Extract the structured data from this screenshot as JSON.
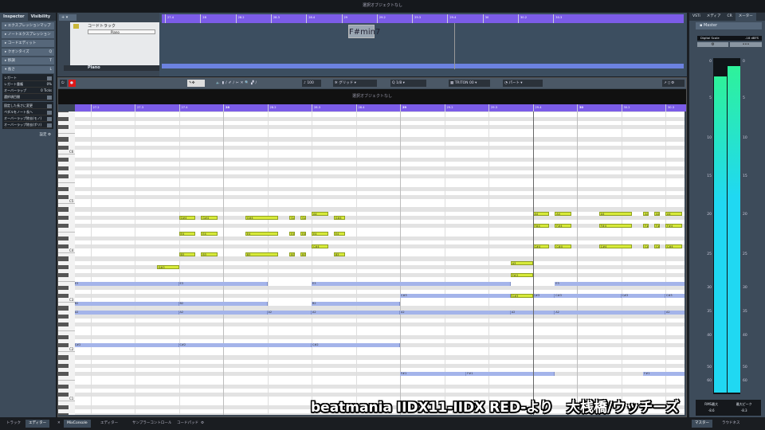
{
  "title": "選択オブジェクトなし",
  "inspector": {
    "tabs": [
      "Inspector",
      "Visibility"
    ],
    "sections": [
      "エクスプレッションマップ",
      "ノートエクスプレッション",
      "コードエディット",
      "クオンタイズ",
      "移調",
      "長さ"
    ],
    "length_rows": [
      {
        "label": "レガート",
        "value": ""
      },
      {
        "label": "レガート重複",
        "value": "0%"
      },
      {
        "label": "オーバーラップ",
        "value": "0 Ticks"
      },
      {
        "label": "選択項目間",
        "value": ""
      }
    ],
    "actions": [
      "固定した長さに変更",
      "ペダルをノート長へ",
      "オーバーラップ除去(モノ)",
      "オーバーラップ除去(ポリ)"
    ],
    "settings": "設定"
  },
  "arrange": {
    "chord_track": "コードトラック",
    "instrument": "Piano",
    "track_name": "Piano",
    "chord": "F#min7",
    "ruler": [
      "27.4",
      "28",
      "28.2",
      "28.3",
      "28.4",
      "29",
      "29.2",
      "29.3",
      "29.4",
      "30",
      "30.2",
      "30.3"
    ]
  },
  "toolbar": {
    "velocity": "100",
    "grid": "グリッド",
    "quantize": "1/8",
    "instrument": "TRITON 00",
    "part": "パート"
  },
  "editor": {
    "info": "選択オブジェクトなし",
    "ruler": [
      "27.2",
      "27.3",
      "27.4",
      "28",
      "28.2",
      "28.3",
      "28.4",
      "29",
      "29.2",
      "29.3",
      "29.4",
      "30",
      "30.2",
      "30.3"
    ],
    "octaves": [
      "C1",
      "C2",
      "C3",
      "C4",
      "C5",
      "C6"
    ],
    "playhead_beat": 11
  },
  "notes": [
    {
      "p": 68,
      "n": "G#4",
      "s": 3,
      "e": 3.375,
      "c": "y"
    },
    {
      "p": 68,
      "n": "G#4",
      "s": 3.5,
      "e": 3.875,
      "c": "y"
    },
    {
      "p": 68,
      "n": "G#4",
      "s": 4.5,
      "e": 5.25,
      "c": "y"
    },
    {
      "p": 68,
      "n": "G#4",
      "s": 5.5,
      "e": 5.625,
      "c": "y"
    },
    {
      "p": 68,
      "n": "G#4",
      "s": 5.75,
      "e": 5.875,
      "c": "y"
    },
    {
      "p": 69,
      "n": "A4",
      "s": 6,
      "e": 6.375,
      "c": "y"
    },
    {
      "p": 68,
      "n": "G#4",
      "s": 6.5,
      "e": 6.75,
      "c": "y"
    },
    {
      "p": 64,
      "n": "E4",
      "s": 3,
      "e": 3.375,
      "c": "y"
    },
    {
      "p": 64,
      "n": "E4",
      "s": 3.5,
      "e": 3.875,
      "c": "y"
    },
    {
      "p": 64,
      "n": "E4",
      "s": 4.5,
      "e": 5.25,
      "c": "y"
    },
    {
      "p": 64,
      "n": "E4",
      "s": 5.5,
      "e": 5.625,
      "c": "y"
    },
    {
      "p": 64,
      "n": "E4",
      "s": 5.75,
      "e": 5.875,
      "c": "y"
    },
    {
      "p": 64,
      "n": "E4",
      "s": 6,
      "e": 6.375,
      "c": "y"
    },
    {
      "p": 64,
      "n": "E4",
      "s": 6.5,
      "e": 6.75,
      "c": "y"
    },
    {
      "p": 61,
      "n": "C#4",
      "s": 6,
      "e": 6.375,
      "c": "y"
    },
    {
      "p": 59,
      "n": "B3",
      "s": 3,
      "e": 3.375,
      "c": "y"
    },
    {
      "p": 59,
      "n": "B3",
      "s": 3.5,
      "e": 3.875,
      "c": "y"
    },
    {
      "p": 59,
      "n": "B3",
      "s": 4.5,
      "e": 5.25,
      "c": "y"
    },
    {
      "p": 59,
      "n": "B3",
      "s": 5.5,
      "e": 5.625,
      "c": "y"
    },
    {
      "p": 59,
      "n": "B3",
      "s": 5.75,
      "e": 5.875,
      "c": "y"
    },
    {
      "p": 59,
      "n": "B3",
      "s": 6.5,
      "e": 6.75,
      "c": "y"
    },
    {
      "p": 56,
      "n": "G#3",
      "s": 2.5,
      "e": 3,
      "c": "y"
    },
    {
      "p": 52,
      "n": "E3",
      "s": 2.5,
      "e": 3,
      "c": "y"
    },
    {
      "p": 47,
      "n": "B2",
      "s": 2.5,
      "e": 3,
      "c": "y"
    },
    {
      "p": 52,
      "n": "E3",
      "s": 0.625,
      "e": 3,
      "c": "b"
    },
    {
      "p": 52,
      "n": "E3",
      "s": 3,
      "e": 5,
      "c": "b"
    },
    {
      "p": 52,
      "n": "E3",
      "s": 6,
      "e": 10.5,
      "c": "b"
    },
    {
      "p": 52,
      "n": "E3",
      "s": 11.5,
      "e": 14.5,
      "c": "b"
    },
    {
      "p": 47,
      "n": "B2",
      "s": 0.625,
      "e": 3,
      "c": "b"
    },
    {
      "p": 47,
      "n": "B2",
      "s": 3,
      "e": 5,
      "c": "b"
    },
    {
      "p": 47,
      "n": "B2",
      "s": 6,
      "e": 8,
      "c": "b"
    },
    {
      "p": 45,
      "n": "A2",
      "s": 0.625,
      "e": 3,
      "c": "b"
    },
    {
      "p": 45,
      "n": "A2",
      "s": 3,
      "e": 5,
      "c": "b"
    },
    {
      "p": 45,
      "n": "A2",
      "s": 5,
      "e": 6,
      "c": "b"
    },
    {
      "p": 45,
      "n": "A2",
      "s": 6,
      "e": 8,
      "c": "b"
    },
    {
      "p": 45,
      "n": "A2",
      "s": 8,
      "e": 10.5,
      "c": "b"
    },
    {
      "p": 45,
      "n": "A2",
      "s": 10.5,
      "e": 11.5,
      "c": "b"
    },
    {
      "p": 45,
      "n": "A2",
      "s": 11.5,
      "e": 14,
      "c": "b"
    },
    {
      "p": 45,
      "n": "A2",
      "s": 14,
      "e": 14.5,
      "c": "b"
    },
    {
      "p": 37,
      "n": "C#2",
      "s": 0.625,
      "e": 3,
      "c": "b"
    },
    {
      "p": 37,
      "n": "C#2",
      "s": 3,
      "e": 6,
      "c": "b"
    },
    {
      "p": 37,
      "n": "C#2",
      "s": 6,
      "e": 8,
      "c": "b"
    },
    {
      "p": 49,
      "n": "C#3",
      "s": 8,
      "e": 10.5,
      "c": "b"
    },
    {
      "p": 49,
      "n": "C#3",
      "s": 10.5,
      "e": 11,
      "c": "y"
    },
    {
      "p": 49,
      "n": "C#3",
      "s": 11,
      "e": 11.5,
      "c": "b"
    },
    {
      "p": 49,
      "n": "C#3",
      "s": 11.5,
      "e": 13,
      "c": "b"
    },
    {
      "p": 49,
      "n": "C#3",
      "s": 13,
      "e": 14,
      "c": "b"
    },
    {
      "p": 49,
      "n": "C#3",
      "s": 14,
      "e": 14.5,
      "c": "b"
    },
    {
      "p": 57,
      "n": "A3",
      "s": 10.5,
      "e": 11,
      "c": "y"
    },
    {
      "p": 54,
      "n": "F#3",
      "s": 10.5,
      "e": 11,
      "c": "y"
    },
    {
      "p": 69,
      "n": "A4",
      "s": 11,
      "e": 11.375,
      "c": "y"
    },
    {
      "p": 69,
      "n": "A4",
      "s": 11.5,
      "e": 11.875,
      "c": "y"
    },
    {
      "p": 69,
      "n": "A4",
      "s": 12.5,
      "e": 13.25,
      "c": "y"
    },
    {
      "p": 69,
      "n": "A4",
      "s": 13.5,
      "e": 13.625,
      "c": "y"
    },
    {
      "p": 69,
      "n": "A4",
      "s": 13.75,
      "e": 13.875,
      "c": "y"
    },
    {
      "p": 69,
      "n": "A4",
      "s": 14,
      "e": 14.375,
      "c": "y"
    },
    {
      "p": 66,
      "n": "F#4",
      "s": 11,
      "e": 11.375,
      "c": "y"
    },
    {
      "p": 66,
      "n": "F#4",
      "s": 11.5,
      "e": 11.875,
      "c": "y"
    },
    {
      "p": 66,
      "n": "F#4",
      "s": 12.5,
      "e": 13.25,
      "c": "y"
    },
    {
      "p": 66,
      "n": "F#4",
      "s": 13.5,
      "e": 13.625,
      "c": "y"
    },
    {
      "p": 66,
      "n": "F#4",
      "s": 13.75,
      "e": 13.875,
      "c": "y"
    },
    {
      "p": 66,
      "n": "F#4",
      "s": 14,
      "e": 14.375,
      "c": "y"
    },
    {
      "p": 61,
      "n": "C#4",
      "s": 11,
      "e": 11.375,
      "c": "y"
    },
    {
      "p": 61,
      "n": "C#4",
      "s": 11.5,
      "e": 11.875,
      "c": "y"
    },
    {
      "p": 61,
      "n": "C#4",
      "s": 12.5,
      "e": 13.25,
      "c": "y"
    },
    {
      "p": 61,
      "n": "C#4",
      "s": 13.5,
      "e": 13.625,
      "c": "y"
    },
    {
      "p": 61,
      "n": "C#4",
      "s": 13.75,
      "e": 13.875,
      "c": "y"
    },
    {
      "p": 61,
      "n": "C#4",
      "s": 14,
      "e": 14.375,
      "c": "y"
    },
    {
      "p": 30,
      "n": "F#1",
      "s": 8,
      "e": 9.5,
      "c": "b"
    },
    {
      "p": 30,
      "n": "F#1",
      "s": 9.5,
      "e": 11.5,
      "c": "b"
    },
    {
      "p": 30,
      "n": "F#1",
      "s": 13.5,
      "e": 14.5,
      "c": "b"
    }
  ],
  "right": {
    "tabs": [
      "VSTi",
      "メディア",
      "CR",
      "メーター"
    ],
    "master": "Master",
    "scale_label": "Digital Scale",
    "scale_value": "-18 dBFS",
    "meter_ticks": [
      "0",
      "5",
      "10",
      "15",
      "20",
      "25",
      "30",
      "35",
      "40",
      "50",
      "60"
    ],
    "meter_levels_db": [
      -2,
      -0.5
    ],
    "rms_label": "RMS最大",
    "rms_value": "-8.6",
    "peak_label": "最大ピーク",
    "peak_value": "-8.3"
  },
  "bottom": {
    "left_tabs": [
      "トラック",
      "エディター"
    ],
    "mid_tabs": [
      "MixConsole",
      "エディター",
      "サンプラーコントロール",
      "コードパッド"
    ],
    "right_tabs": [
      "マスター",
      "ラウドネス"
    ]
  },
  "subtitle": "beatmania IIDX11-IIDX RED-より　大桟橋/ウッチーズ",
  "colors": {
    "ruler": "#7b5ce8",
    "note_selected": "#d7ea3a",
    "note": "#a4b4ea",
    "meter_top": "#2ef29a",
    "meter_bottom": "#20d8f2"
  }
}
